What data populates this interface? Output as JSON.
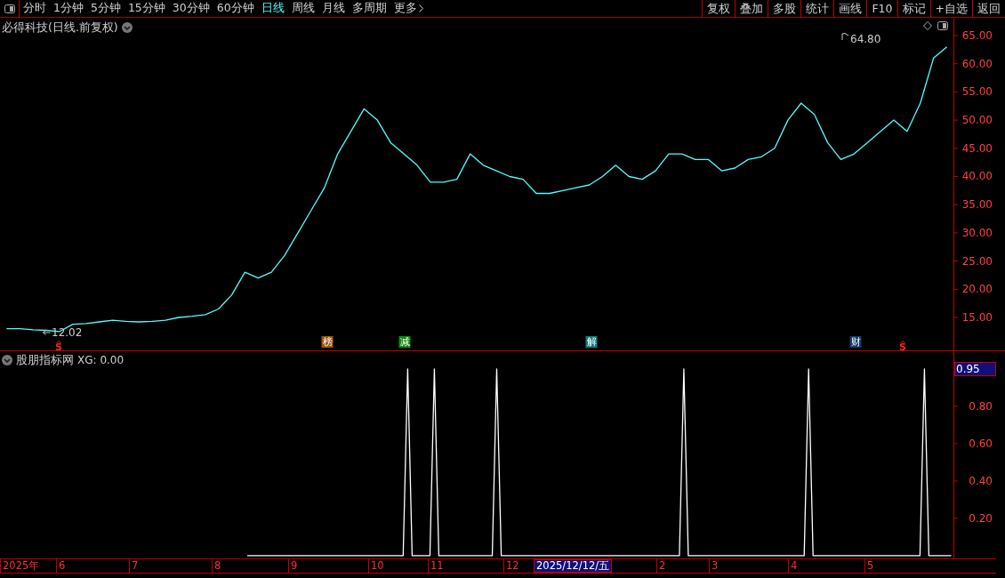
{
  "toolbar": {
    "periods": [
      {
        "label": "分时",
        "selected": false
      },
      {
        "label": "1分钟",
        "selected": false
      },
      {
        "label": "5分钟",
        "selected": false
      },
      {
        "label": "15分钟",
        "selected": false
      },
      {
        "label": "30分钟",
        "selected": false
      },
      {
        "label": "60分钟",
        "selected": false
      },
      {
        "label": "日线",
        "selected": true
      },
      {
        "label": "周线",
        "selected": false
      },
      {
        "label": "月线",
        "selected": false
      },
      {
        "label": "多周期",
        "selected": false
      },
      {
        "label": "更多",
        "selected": false
      }
    ],
    "buttons": [
      "复权",
      "叠加",
      "多股",
      "统计",
      "画线",
      "F10",
      "标记",
      "+自选",
      "返回"
    ]
  },
  "main_chart": {
    "title": "必得科技(日线.前复权)",
    "chart_data": {
      "type": "line",
      "categories": [
        null,
        null,
        null,
        null,
        null,
        null,
        null,
        null,
        null,
        null,
        null,
        null,
        null,
        null,
        null,
        null,
        null,
        null,
        null,
        null,
        null,
        null,
        null,
        null,
        null,
        null,
        null,
        null,
        null,
        null,
        null,
        null,
        null,
        null,
        null,
        null,
        null,
        null,
        null,
        null,
        null,
        null,
        null,
        null,
        null,
        null,
        null,
        null,
        null,
        null,
        null,
        null,
        null,
        null,
        null,
        null,
        null,
        null,
        null,
        null,
        null,
        null,
        null,
        null,
        null,
        null,
        null,
        null,
        null,
        null,
        null,
        null
      ],
      "series": [
        {
          "color": "#54fcfc",
          "values": [
            13,
            13,
            12.8,
            12.7,
            12.5,
            13.8,
            13.9,
            14.2,
            14.5,
            14.3,
            14.2,
            14.3,
            14.5,
            15,
            15.2,
            15.5,
            16.5,
            19,
            23,
            22,
            23,
            26,
            30,
            34,
            38,
            44,
            48,
            52,
            50,
            46,
            44,
            42,
            39,
            39,
            39.5,
            44,
            42,
            41,
            40,
            39.5,
            37,
            37,
            37.5,
            38,
            38.5,
            40,
            42,
            40,
            39.5,
            41,
            44,
            44,
            43,
            43,
            41,
            41.5,
            43,
            43.5,
            45,
            50,
            53,
            51,
            46,
            43,
            44,
            46,
            48,
            50,
            48,
            53,
            61,
            63
          ]
        }
      ],
      "ylim": [
        9.0,
        68.15
      ],
      "yticks": [
        {
          "value": 65,
          "label": "65.00"
        },
        {
          "value": 60,
          "label": "60.00"
        },
        {
          "value": 55,
          "label": "55.00"
        },
        {
          "value": 50,
          "label": "50.00"
        },
        {
          "value": 45,
          "label": "45.00"
        },
        {
          "value": 40,
          "label": "40.00"
        },
        {
          "value": 35,
          "label": "35.00"
        },
        {
          "value": 30,
          "label": "30.00"
        },
        {
          "value": 25,
          "label": "25.00"
        },
        {
          "value": 20,
          "label": "20.00"
        },
        {
          "value": 15,
          "label": "15.00"
        }
      ],
      "annotations": [
        "12.02",
        "64.80"
      ]
    },
    "markers": [
      {
        "kind": "signal",
        "text": "S",
        "color": "#ff2020"
      },
      {
        "kind": "tag",
        "text": "榜",
        "color": "#a0520e"
      },
      {
        "kind": "tag",
        "text": "减",
        "color": "#108a10"
      },
      {
        "kind": "tag",
        "text": "解",
        "color": "#0e7a7a"
      },
      {
        "kind": "tag",
        "text": "财",
        "color": "#123a6a"
      },
      {
        "kind": "signal",
        "text": "S",
        "color": "#ff2020"
      }
    ]
  },
  "indicator": {
    "title": "股朋指标网",
    "reading": "XG: 0.00",
    "cursor_value": "0.95",
    "chart_data": {
      "type": "line",
      "categories": [
        null,
        null,
        null,
        null,
        null,
        null,
        null,
        null,
        null,
        null,
        null,
        null,
        null,
        null,
        null,
        null,
        null,
        null,
        null,
        null,
        null,
        null,
        null,
        null,
        null,
        null,
        null,
        null,
        null,
        null,
        null,
        null,
        null,
        null,
        null,
        null,
        null,
        null,
        null,
        null,
        null,
        null,
        null,
        null,
        null,
        null,
        null,
        null,
        null,
        null,
        null,
        null,
        null,
        null,
        null,
        null,
        null,
        null,
        null,
        null,
        null,
        null,
        null,
        null,
        null,
        null,
        null,
        null,
        null,
        null,
        null,
        null,
        null,
        null,
        null,
        null,
        null,
        null,
        null,
        null,
        null,
        null,
        null,
        null,
        null,
        null,
        null,
        null,
        null,
        null,
        null,
        null,
        null,
        null,
        null,
        null,
        null,
        null,
        null,
        null,
        null,
        null,
        null,
        null,
        null,
        null,
        null,
        null,
        null,
        null,
        null,
        null,
        null,
        null,
        null,
        null,
        null,
        null,
        null,
        null,
        null,
        null,
        null,
        null,
        null,
        null,
        null,
        null,
        null,
        null,
        null,
        null,
        null,
        null,
        null,
        null,
        null,
        null,
        null,
        null,
        null,
        null,
        null,
        null,
        null,
        null,
        null,
        null,
        null,
        null,
        null,
        null,
        null,
        null,
        null,
        null,
        null,
        null,
        null,
        null,
        null,
        null,
        null,
        null,
        null,
        null,
        null,
        null,
        null,
        null,
        null,
        null,
        null,
        null,
        null,
        null,
        null,
        null,
        null,
        null,
        null,
        null,
        null,
        null,
        null,
        null,
        null,
        null,
        null,
        null,
        null,
        null,
        null,
        null,
        null,
        null,
        null,
        null,
        null,
        null,
        null,
        null,
        null,
        null,
        null,
        null,
        null,
        null,
        null,
        null,
        null,
        null,
        null,
        null
      ],
      "series": [
        {
          "color": "#ffffff",
          "values": [
            null,
            null,
            null,
            null,
            null,
            null,
            null,
            null,
            null,
            null,
            null,
            null,
            null,
            null,
            null,
            null,
            null,
            null,
            null,
            null,
            null,
            null,
            null,
            null,
            null,
            null,
            null,
            null,
            null,
            null,
            null,
            null,
            null,
            null,
            null,
            null,
            null,
            null,
            null,
            null,
            null,
            null,
            null,
            null,
            null,
            null,
            null,
            null,
            null,
            null,
            null,
            null,
            null,
            null,
            null,
            0,
            0,
            0,
            0,
            0,
            0,
            0,
            0,
            0,
            0,
            0,
            0,
            0,
            0,
            0,
            0,
            0,
            0,
            0,
            0,
            0,
            0,
            0,
            0,
            0,
            0,
            0,
            0,
            0,
            0,
            0,
            0,
            0,
            0,
            0,
            0,
            1,
            0,
            0,
            0,
            0,
            0,
            1,
            0,
            0,
            0,
            0,
            0,
            0,
            0,
            0,
            0,
            0,
            0,
            0,
            0,
            1,
            0,
            0,
            0,
            0,
            0,
            0,
            0,
            0,
            0,
            0,
            0,
            0,
            0,
            0,
            0,
            0,
            0,
            0,
            0,
            0,
            0,
            0,
            0,
            0,
            0,
            0,
            0,
            0,
            0,
            0,
            0,
            0,
            0,
            0,
            0,
            0,
            0,
            0,
            0,
            0,
            0,
            1,
            0,
            0,
            0,
            0,
            0,
            0,
            0,
            0,
            0,
            0,
            0,
            0,
            0,
            0,
            0,
            0,
            0,
            0,
            0,
            0,
            0,
            0,
            0,
            0,
            0,
            0,
            0,
            1,
            0,
            0,
            0,
            0,
            0,
            0,
            0,
            0,
            0,
            0,
            0,
            0,
            0,
            0,
            0,
            0,
            0,
            0,
            0,
            0,
            0,
            0,
            0,
            0,
            0,
            1,
            0,
            0,
            0,
            0,
            0,
            0
          ]
        }
      ],
      "ylim": [
        -0.015,
        1.095
      ],
      "yticks": [
        {
          "value": 0.8,
          "label": "0.80"
        },
        {
          "value": 0.6,
          "label": "0.60"
        },
        {
          "value": 0.4,
          "label": "0.40"
        },
        {
          "value": 0.2,
          "label": "0.20"
        }
      ]
    }
  },
  "date_axis": {
    "labels": [
      "2025年",
      "6",
      "7",
      "8",
      "9",
      "10",
      "11",
      "12",
      "2",
      "3",
      "4",
      "5"
    ],
    "cursor_date": "2025/12/12/五"
  }
}
